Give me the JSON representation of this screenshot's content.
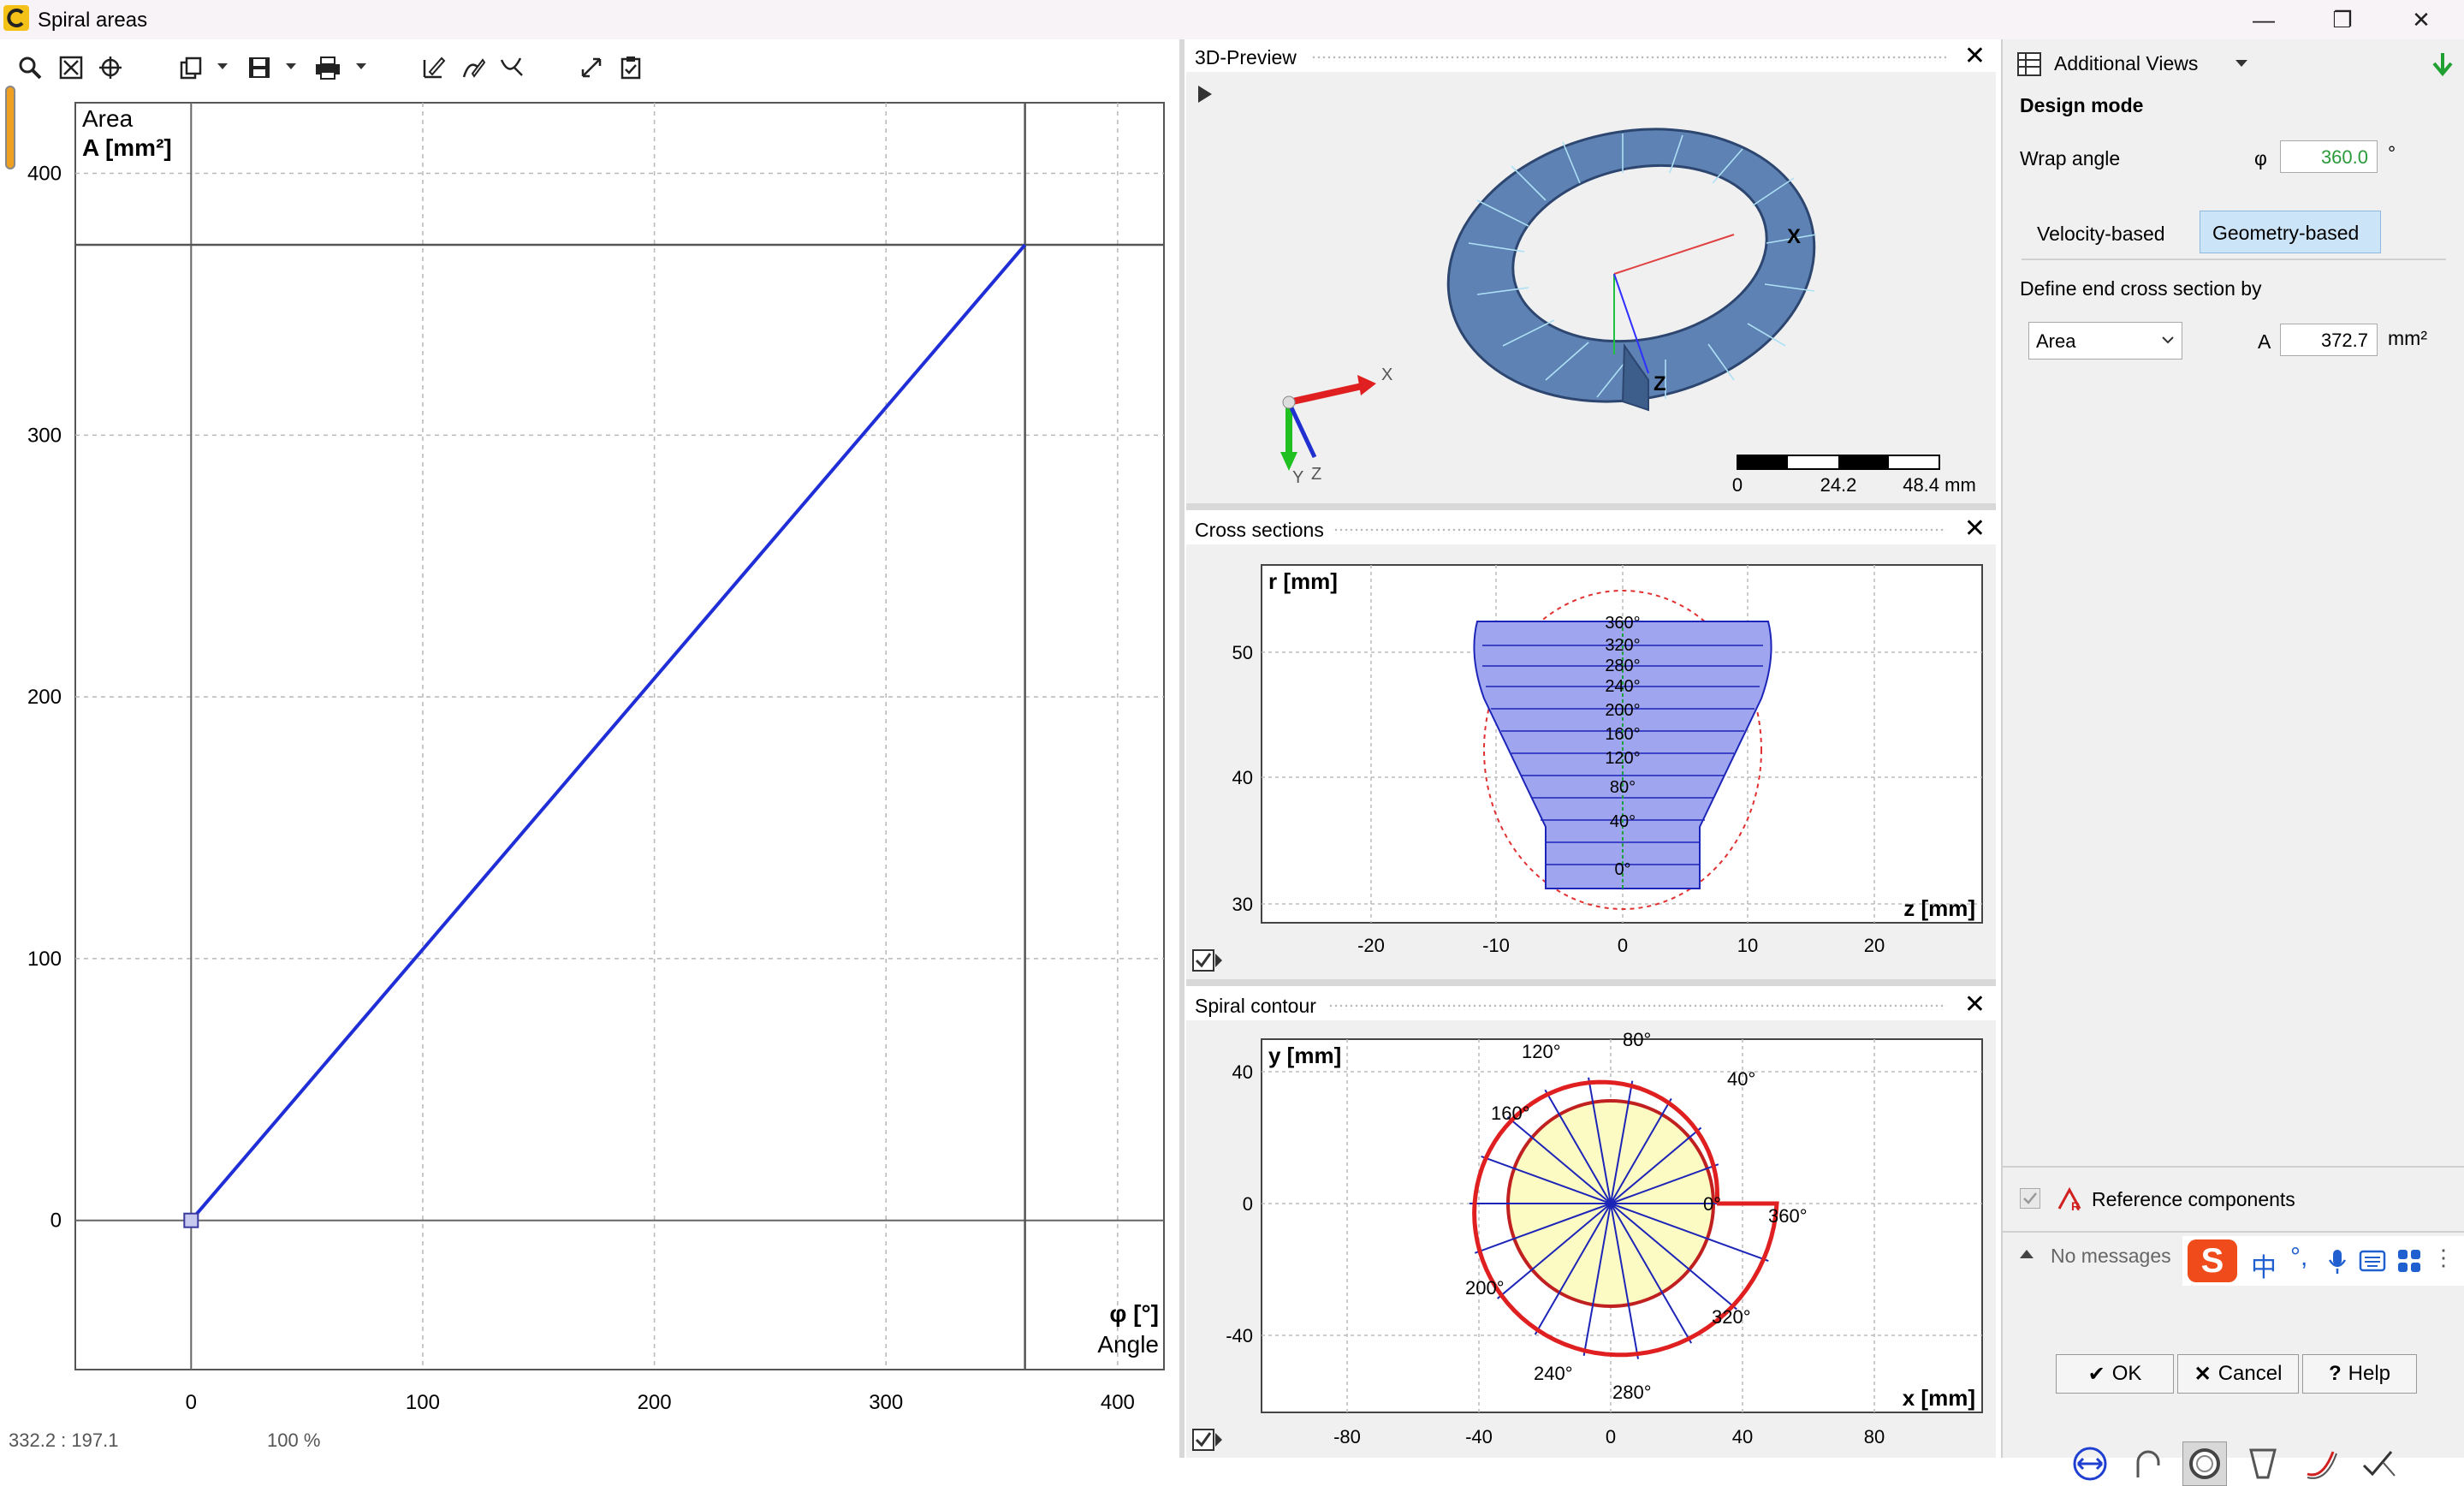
{
  "window": {
    "title": "Spiral areas",
    "minimize": "—",
    "restore": "❐",
    "close": "✕"
  },
  "main_chart": {
    "ylabel_top": "Area",
    "ylabel_bottom": "A [mm²]",
    "xlabel_top": "φ [°]",
    "xlabel_bottom": "Angle",
    "chart_data": {
      "type": "line",
      "x": [
        0,
        360
      ],
      "y": [
        0,
        372.7
      ],
      "xlim": [
        -50,
        420
      ],
      "ylim": [
        -57,
        427
      ],
      "xticks": [
        0,
        100,
        200,
        300,
        400
      ],
      "yticks": [
        0,
        100,
        200,
        300,
        400
      ],
      "grid": true,
      "line_color": "#1f2ed6",
      "reference_lines": {
        "x": 360,
        "y": 372.7
      }
    }
  },
  "status": {
    "coord": "332.2 : 197.1",
    "zoom": "100 %"
  },
  "panels": {
    "preview": {
      "title": "3D-Preview",
      "scale_labels": [
        "0",
        "24.2",
        "48.4 mm"
      ],
      "axis_x": "X",
      "axis_y": "Y",
      "axis_z": "Z"
    },
    "cross": {
      "title": "Cross sections",
      "ylabel": "r [mm]",
      "xlabel": "z [mm]",
      "xticks": [
        "-20",
        "-10",
        "0",
        "10",
        "20"
      ],
      "yticks": [
        "50",
        "40",
        "30"
      ],
      "section_labels": [
        "360°",
        "320°",
        "280°",
        "240°",
        "200°",
        "160°",
        "120°",
        "80°",
        "40°",
        "0°"
      ]
    },
    "spiral": {
      "title": "Spiral contour",
      "ylabel": "y [mm]",
      "xlabel": "x [mm]",
      "xticks": [
        "-80",
        "-40",
        "0",
        "40",
        "80"
      ],
      "yticks": [
        "40",
        "0",
        "-40"
      ],
      "angle_labels": [
        "80°",
        "120°",
        "40°",
        "160°",
        "0°",
        "360°",
        "200°",
        "320°",
        "240°",
        "280°"
      ]
    }
  },
  "right_panel": {
    "header": "Additional Views",
    "design_mode": "Design mode",
    "wrap_angle_label": "Wrap angle",
    "phi_symbol": "φ",
    "wrap_angle_value": "360.0",
    "wrap_angle_unit": "°",
    "velocity_based": "Velocity-based",
    "geometry_based": "Geometry-based",
    "define_end": "Define end cross section by",
    "area_option": "Area",
    "a_symbol": "A",
    "area_value": "372.7",
    "area_unit": "mm²",
    "reference_components": "Reference components",
    "messages": "No messages",
    "ok": "OK",
    "cancel": "Cancel",
    "help": "Help"
  },
  "ime": {
    "lang": "中",
    "punct": "°,"
  }
}
